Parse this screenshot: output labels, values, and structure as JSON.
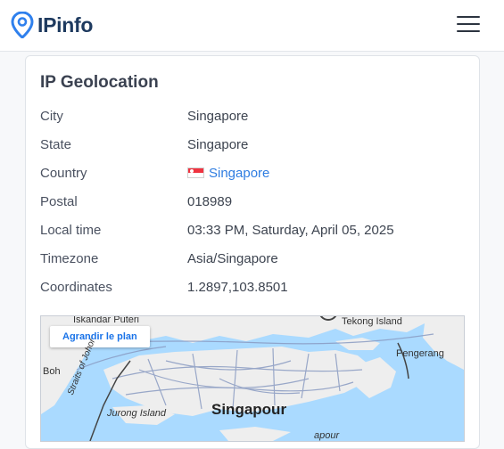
{
  "header": {
    "logo_text": "IPinfo",
    "menu_icon": "hamburger-menu-icon"
  },
  "card": {
    "title": "IP Geolocation",
    "rows": [
      {
        "key": "City",
        "value": "Singapore"
      },
      {
        "key": "State",
        "value": "Singapore"
      },
      {
        "key": "Country",
        "value": "Singapore",
        "flag_icon": "singapore-flag-icon"
      },
      {
        "key": "Postal",
        "value": "018989"
      },
      {
        "key": "Local time",
        "value": "03:33 PM, Saturday, April 05, 2025"
      },
      {
        "key": "Timezone",
        "value": "Asia/Singapore"
      },
      {
        "key": "Coordinates",
        "value": "1.2897,103.8501"
      }
    ]
  },
  "map": {
    "enlarge_label": "Agrandir le plan",
    "labels": {
      "main": "Singapour",
      "iskandar": "Iskandar Puteri",
      "tekong": "Tekong Island",
      "pengerang": "Pengerang",
      "jurong": "Jurong Island",
      "straits": "Straits of Johor",
      "boh": "Boh",
      "bottom": "apour"
    }
  },
  "colors": {
    "link": "#2f7de1",
    "water": "#aadaff",
    "land": "#eeeeee"
  }
}
